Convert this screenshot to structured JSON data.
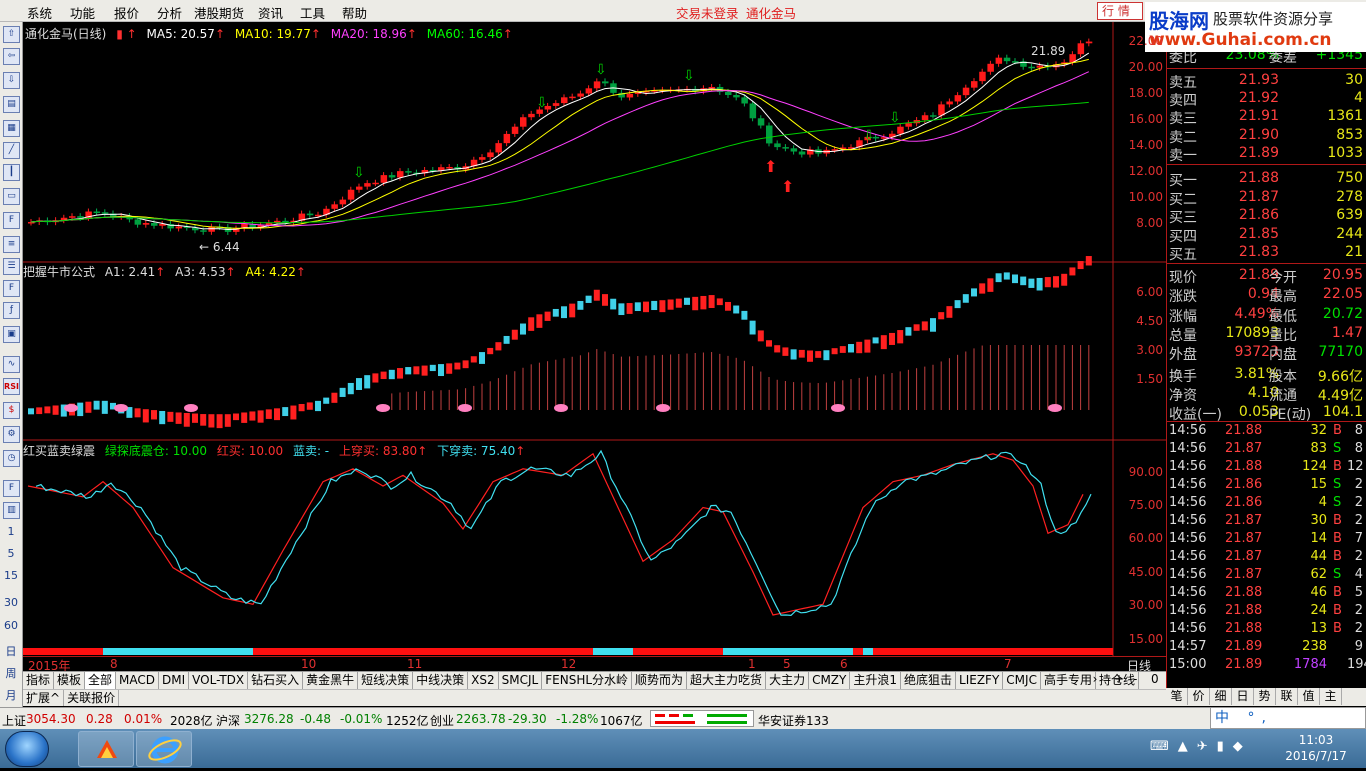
{
  "menu": [
    "系统",
    "功能",
    "报价",
    "分析",
    "港股期货",
    "资讯",
    "工具",
    "帮助"
  ],
  "connection_status": "交易未登录",
  "app_name": "通化金马",
  "quote_button": "行 情",
  "logo": {
    "main": "股海网",
    "sub": "股票软件资源分享",
    "url": "www.Guhai.com.cn"
  },
  "left_tools": {
    "numbers": [
      "1",
      "5",
      "15",
      "30",
      "60"
    ],
    "labels": [
      "日",
      "周",
      "月"
    ],
    "rsi": "RSI"
  },
  "main_panel": {
    "title": "通化金马(日线)",
    "ma5": "MA5: 20.57",
    "ma10": "MA10: 19.77",
    "ma20": "MA20: 18.96",
    "ma60": "MA60: 16.46",
    "high_mark": "21.89",
    "low_mark": "← 6.44",
    "yticks": [
      "22.00",
      "20.00",
      "18.00",
      "16.00",
      "14.00",
      "12.00",
      "10.00",
      "8.00"
    ]
  },
  "panel2": {
    "title": "把握牛市公式",
    "a1": "A1: 2.41",
    "a3": "A3: 4.53",
    "a4": "A4: 4.22",
    "yticks": [
      "6.00",
      "4.50",
      "3.00",
      "1.50"
    ]
  },
  "panel3": {
    "title": "红买蓝卖绿震",
    "green": "绿探底震仓: 10.00",
    "red": "红买: 10.00",
    "blue": "蓝卖: -",
    "up": "上穿买: 83.80",
    "down": "下穿卖: 75.40",
    "yticks": [
      "90.00",
      "75.00",
      "60.00",
      "45.00",
      "30.00",
      "15.00"
    ]
  },
  "xaxis": {
    "labels": [
      "2015年",
      "8",
      "10",
      "11",
      "12",
      "1",
      "5",
      "6",
      "7"
    ],
    "period": "日线"
  },
  "formula_tabs": [
    "指标",
    "模板",
    "全部",
    "MACD",
    "DMI",
    "VOL-TDX",
    "钻石买入",
    "黄金黑牛",
    "短线决策",
    "中线决策",
    "XS2",
    "SMCJL",
    "FENSHL分水岭",
    "顺势而为",
    "超大主力吃货",
    "大主力",
    "CMZY",
    "主升浪1",
    "绝底狙击",
    "LIEZFY",
    "CMJC",
    "高手专用",
    "持仓线"
  ],
  "tab_controls": [
    "+",
    "-",
    "0"
  ],
  "sub_tabs": [
    "扩展^",
    "关联报价"
  ],
  "order_book": {
    "header_left": "委比",
    "header_left_val": "23.08%",
    "header_right": "委差",
    "header_right_val": "+1345",
    "asks": [
      {
        "label": "卖五",
        "price": "21.93",
        "vol": "30"
      },
      {
        "label": "卖四",
        "price": "21.92",
        "vol": "4"
      },
      {
        "label": "卖三",
        "price": "21.91",
        "vol": "1361"
      },
      {
        "label": "卖二",
        "price": "21.90",
        "vol": "853"
      },
      {
        "label": "卖一",
        "price": "21.89",
        "vol": "1033"
      }
    ],
    "bids": [
      {
        "label": "买一",
        "price": "21.88",
        "vol": "750"
      },
      {
        "label": "买二",
        "price": "21.87",
        "vol": "278"
      },
      {
        "label": "买三",
        "price": "21.86",
        "vol": "639"
      },
      {
        "label": "买四",
        "price": "21.85",
        "vol": "244"
      },
      {
        "label": "买五",
        "price": "21.83",
        "vol": "21"
      }
    ]
  },
  "stats": [
    {
      "l": "现价",
      "v": "21.89",
      "l2": "今开",
      "v2": "20.95"
    },
    {
      "l": "涨跌",
      "v": "0.94",
      "l2": "最高",
      "v2": "22.05"
    },
    {
      "l": "涨幅",
      "v": "4.49%",
      "l2": "最低",
      "v2": "20.72"
    },
    {
      "l": "总量",
      "v": "170893",
      "l2": "量比",
      "v2": "1.47"
    },
    {
      "l": "外盘",
      "v": "93723",
      "l2": "内盘",
      "v2": "77170"
    },
    {
      "l": "换手",
      "v": "3.81%",
      "l2": "股本",
      "v2": "9.66亿"
    },
    {
      "l": "净资",
      "v": "4.10",
      "l2": "流通",
      "v2": "4.49亿"
    },
    {
      "l": "收益(一)",
      "v": "0.053",
      "l2": "PE(动)",
      "v2": "104.1"
    }
  ],
  "ticks": [
    {
      "t": "14:56",
      "p": "21.88",
      "q": "32",
      "s": "B",
      "n": "8"
    },
    {
      "t": "14:56",
      "p": "21.87",
      "q": "83",
      "s": "S",
      "n": "8"
    },
    {
      "t": "14:56",
      "p": "21.88",
      "q": "124",
      "s": "B",
      "n": "12"
    },
    {
      "t": "14:56",
      "p": "21.86",
      "q": "15",
      "s": "S",
      "n": "2"
    },
    {
      "t": "14:56",
      "p": "21.86",
      "q": "4",
      "s": "S",
      "n": "2"
    },
    {
      "t": "14:56",
      "p": "21.87",
      "q": "30",
      "s": "B",
      "n": "2"
    },
    {
      "t": "14:56",
      "p": "21.87",
      "q": "14",
      "s": "B",
      "n": "7"
    },
    {
      "t": "14:56",
      "p": "21.87",
      "q": "44",
      "s": "B",
      "n": "2"
    },
    {
      "t": "14:56",
      "p": "21.87",
      "q": "62",
      "s": "S",
      "n": "4"
    },
    {
      "t": "14:56",
      "p": "21.88",
      "q": "46",
      "s": "B",
      "n": "5"
    },
    {
      "t": "14:56",
      "p": "21.88",
      "q": "24",
      "s": "B",
      "n": "2"
    },
    {
      "t": "14:56",
      "p": "21.88",
      "q": "13",
      "s": "B",
      "n": "2"
    },
    {
      "t": "14:57",
      "p": "21.89",
      "q": "238",
      "s": "",
      "n": "9"
    },
    {
      "t": "15:00",
      "p": "21.89",
      "q": "1784",
      "s": "",
      "n": "194"
    }
  ],
  "right_tabs": [
    "笔",
    "价",
    "细",
    "日",
    "势",
    "联",
    "值",
    "主"
  ],
  "status_bar": {
    "sh_label": "上证",
    "sh_val": "3054.30",
    "sh_chg": "0.28",
    "sh_pct": "0.01%",
    "sh_amt": "2028亿",
    "sz_label": "沪深",
    "sz_val": "3276.28",
    "sz_chg": "-0.48",
    "sz_pct": "-0.01%",
    "sz_amt": "1252亿",
    "cy_label": "创业",
    "cy_val": "2263.78",
    "cy_chg": "-29.30",
    "cy_pct": "-1.28%",
    "cy_amt": "1067亿",
    "broker": "华安证券133"
  },
  "ime": "中 °,",
  "clock": {
    "time": "11:03",
    "date": "2016/7/17"
  },
  "colors": {
    "up": "#ff3c3c",
    "down": "#00b050",
    "ma5": "#ffffff",
    "ma10": "#ffff00",
    "ma20": "#ff40ff",
    "ma60": "#00ff00",
    "cyan": "#40e0f0"
  }
}
